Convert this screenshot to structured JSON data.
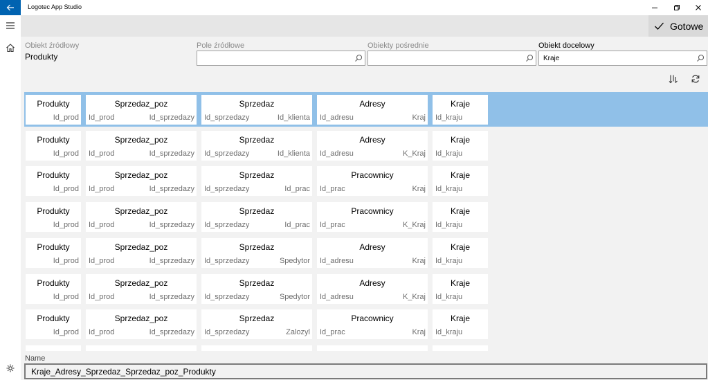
{
  "app": {
    "title": "Logotec App Studio"
  },
  "command_bar": {
    "done_label": "Gotowe"
  },
  "filters": {
    "source_object": {
      "label": "Obiekt źródłowy",
      "value": "Produkty"
    },
    "source_field": {
      "label": "Pole źródłowe",
      "value": ""
    },
    "intermediate": {
      "label": "Obiekty pośrednie",
      "value": ""
    },
    "target": {
      "label": "Obiekt docelowy",
      "value": "Kraje"
    }
  },
  "paths": [
    {
      "selected": true,
      "steps": [
        {
          "name": "Produkty",
          "left": "",
          "right": "Id_prod"
        },
        {
          "name": "Sprzedaz_poz",
          "left": "Id_prod",
          "right": "Id_sprzedazy"
        },
        {
          "name": "Sprzedaz",
          "left": "Id_sprzedazy",
          "right": "Id_klienta"
        },
        {
          "name": "Adresy",
          "left": "Id_adresu",
          "right": "Kraj"
        },
        {
          "name": "Kraje",
          "left": "Id_kraju",
          "right": ""
        }
      ]
    },
    {
      "selected": false,
      "steps": [
        {
          "name": "Produkty",
          "left": "",
          "right": "Id_prod"
        },
        {
          "name": "Sprzedaz_poz",
          "left": "Id_prod",
          "right": "Id_sprzedazy"
        },
        {
          "name": "Sprzedaz",
          "left": "Id_sprzedazy",
          "right": "Id_klienta"
        },
        {
          "name": "Adresy",
          "left": "Id_adresu",
          "right": "K_Kraj"
        },
        {
          "name": "Kraje",
          "left": "Id_kraju",
          "right": ""
        }
      ]
    },
    {
      "selected": false,
      "steps": [
        {
          "name": "Produkty",
          "left": "",
          "right": "Id_prod"
        },
        {
          "name": "Sprzedaz_poz",
          "left": "Id_prod",
          "right": "Id_sprzedazy"
        },
        {
          "name": "Sprzedaz",
          "left": "Id_sprzedazy",
          "right": "Id_prac"
        },
        {
          "name": "Pracownicy",
          "left": "Id_prac",
          "right": "Kraj"
        },
        {
          "name": "Kraje",
          "left": "Id_kraju",
          "right": ""
        }
      ]
    },
    {
      "selected": false,
      "steps": [
        {
          "name": "Produkty",
          "left": "",
          "right": "Id_prod"
        },
        {
          "name": "Sprzedaz_poz",
          "left": "Id_prod",
          "right": "Id_sprzedazy"
        },
        {
          "name": "Sprzedaz",
          "left": "Id_sprzedazy",
          "right": "Id_prac"
        },
        {
          "name": "Pracownicy",
          "left": "Id_prac",
          "right": "K_Kraj"
        },
        {
          "name": "Kraje",
          "left": "Id_kraju",
          "right": ""
        }
      ]
    },
    {
      "selected": false,
      "steps": [
        {
          "name": "Produkty",
          "left": "",
          "right": "Id_prod"
        },
        {
          "name": "Sprzedaz_poz",
          "left": "Id_prod",
          "right": "Id_sprzedazy"
        },
        {
          "name": "Sprzedaz",
          "left": "Id_sprzedazy",
          "right": "Spedytor"
        },
        {
          "name": "Adresy",
          "left": "Id_adresu",
          "right": "Kraj"
        },
        {
          "name": "Kraje",
          "left": "Id_kraju",
          "right": ""
        }
      ]
    },
    {
      "selected": false,
      "steps": [
        {
          "name": "Produkty",
          "left": "",
          "right": "Id_prod"
        },
        {
          "name": "Sprzedaz_poz",
          "left": "Id_prod",
          "right": "Id_sprzedazy"
        },
        {
          "name": "Sprzedaz",
          "left": "Id_sprzedazy",
          "right": "Spedytor"
        },
        {
          "name": "Adresy",
          "left": "Id_adresu",
          "right": "K_Kraj"
        },
        {
          "name": "Kraje",
          "left": "Id_kraju",
          "right": ""
        }
      ]
    },
    {
      "selected": false,
      "steps": [
        {
          "name": "Produkty",
          "left": "",
          "right": "Id_prod"
        },
        {
          "name": "Sprzedaz_poz",
          "left": "Id_prod",
          "right": "Id_sprzedazy"
        },
        {
          "name": "Sprzedaz",
          "left": "Id_sprzedazy",
          "right": "Zalozyl"
        },
        {
          "name": "Pracownicy",
          "left": "Id_prac",
          "right": "Kraj"
        },
        {
          "name": "Kraje",
          "left": "Id_kraju",
          "right": ""
        }
      ]
    }
  ],
  "name_field": {
    "label": "Name",
    "value": "Kraje_Adresy_Sprzedaz_Sprzedaz_poz_Produkty"
  },
  "icons": {
    "back": "back-arrow-icon",
    "minimize": "minimize-icon",
    "restore": "restore-icon",
    "close": "close-icon",
    "menu": "hamburger-menu-icon",
    "home": "home-icon",
    "settings": "settings-icon",
    "done": "checkmark-icon",
    "search": "search-icon",
    "sort": "sort-icon",
    "refresh": "refresh-icon"
  },
  "colors": {
    "accent": "#0063b1",
    "selected_row": "#90c0e8",
    "card": "#ffffff",
    "background": "#f2f2f2"
  }
}
